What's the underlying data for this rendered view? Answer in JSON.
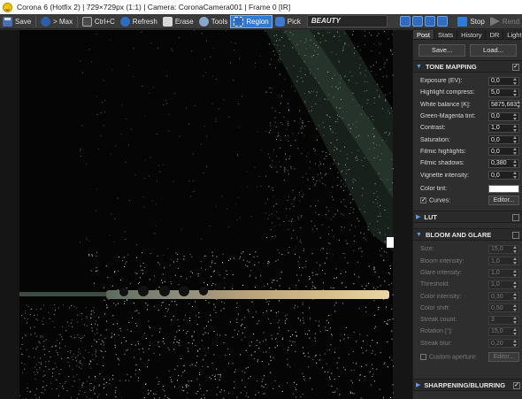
{
  "window": {
    "title": "Corona 6 (Hotfix 2) | 729×729px (1:1) | Camera: CoronaCamera001 | Frame 0 [IR]"
  },
  "toolbar": {
    "save": "Save",
    "max": "> Max",
    "copy": "Ctrl+C",
    "refresh": "Refresh",
    "erase": "Erase",
    "tools": "Tools",
    "region": "Region",
    "pick": "Pick",
    "render_elem": "BEAUTY",
    "stop": "Stop",
    "render": "Rend"
  },
  "panel": {
    "tabs": [
      "Post",
      "Stats",
      "History",
      "DR",
      "LightM"
    ],
    "save_btn": "Save...",
    "load_btn": "Load...",
    "tone_mapping": {
      "header": "TONE MAPPING",
      "rows": [
        {
          "label": "Exposure (EV):",
          "value": "0,0"
        },
        {
          "label": "Highlight compress:",
          "value": "5,0"
        },
        {
          "label": "White balance [K]:",
          "value": "5875,683"
        },
        {
          "label": "Green-Magenta tint:",
          "value": "0,0"
        },
        {
          "label": "Contrast:",
          "value": "1,0"
        },
        {
          "label": "Saturation:",
          "value": "0,0"
        },
        {
          "label": "Filmic highlights:",
          "value": "0,0"
        },
        {
          "label": "Filmic shadows:",
          "value": "0,380"
        },
        {
          "label": "Vignette intensity:",
          "value": "0,0"
        }
      ],
      "color_tint": "Color tint:",
      "curves": "Curves:",
      "editor": "Editor..."
    },
    "lut": {
      "header": "LUT"
    },
    "bloom_glare": {
      "header": "BLOOM AND GLARE",
      "rows": [
        {
          "label": "Size:",
          "value": "15,0"
        },
        {
          "label": "Bloom intensity:",
          "value": "1,0"
        },
        {
          "label": "Glare intensity:",
          "value": "1,0"
        },
        {
          "label": "Threshold:",
          "value": "1,0"
        },
        {
          "label": "Color intensity:",
          "value": "0,30"
        },
        {
          "label": "Color shift:",
          "value": "0,50"
        },
        {
          "label": "Streak count:",
          "value": "3"
        },
        {
          "label": "Rotation [°]:",
          "value": "15,0"
        },
        {
          "label": "Streak blur:",
          "value": "0,20"
        }
      ],
      "custom_aperture": "Custom aperture:",
      "editor": "Editor..."
    },
    "sharpening": {
      "header": "SHARPENING/BLURRING"
    }
  }
}
